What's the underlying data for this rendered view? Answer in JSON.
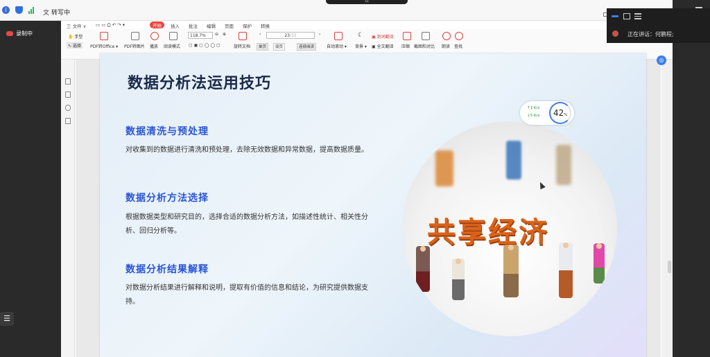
{
  "topbar": {
    "transcribe_icon": "文",
    "transcribe_label": "转写中",
    "center_label": "以"
  },
  "left_sidebar": {
    "recording_label": "录制中",
    "list_icon": "☰"
  },
  "menu": {
    "items": [
      {
        "label": "三 文件 ∨"
      },
      {
        "label": "开始"
      },
      {
        "label": "插入"
      },
      {
        "label": "批注"
      },
      {
        "label": "编辑"
      },
      {
        "label": "页面"
      },
      {
        "label": "保护"
      },
      {
        "label": "转换"
      }
    ]
  },
  "ribbon": {
    "hand": "手型",
    "select": "选择",
    "pdf_to_office": "PDF转Office ▾",
    "pdf_to_image": "PDF转图片",
    "play": "播放",
    "read_mode": "阅读模式",
    "zoom": "118.7%",
    "rotate": "旋转文档",
    "single": "单页",
    "double": "双页",
    "continuous": "连续阅读",
    "page_current": "23",
    "page_total": "/32",
    "auto_scroll": "自动滚动 ▾",
    "background": "背景 ▾",
    "translate_word": "划词翻译",
    "translate_full": "全文翻译",
    "compress": "压缩",
    "screenshot_compare": "截图和对比",
    "read_aloud": "朗读",
    "find": "查找"
  },
  "slide": {
    "title": "数据分析法运用技巧",
    "sections": [
      {
        "heading": "数据清洗与预处理",
        "body": "对收集到的数据进行清洗和预处理，去除无效数据和异常数据，提高数据质量。"
      },
      {
        "heading": "数据分析方法选择",
        "body": "根据数据类型和研究目的，选择合适的数据分析方法，如描述性统计、相关性分析、回归分析等。"
      },
      {
        "heading": "数据分析结果解释",
        "body": "对数据分析结果进行解释和说明，提取有价值的信息和结论，为研究提供数据支持。"
      }
    ],
    "image_text": "共享经济"
  },
  "speed_widget": {
    "upload": "↑1  K/s",
    "download": "↓5  K/s",
    "percent": "42",
    "percent_unit": "%"
  },
  "speaker_panel": {
    "label": "正在讲话：何鹏程;"
  }
}
